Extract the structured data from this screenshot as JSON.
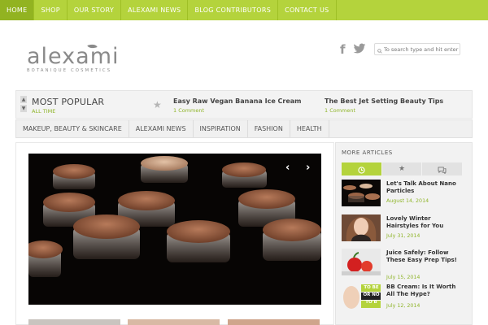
{
  "topnav": {
    "items": [
      "HOME",
      "SHOP",
      "OUR STORY",
      "ALEXAMI NEWS",
      "BLOG CONTRIBUTORS",
      "CONTACT US"
    ],
    "active_index": 0
  },
  "brand": {
    "name": "alexami",
    "tagline": "BOTANIQUE COSMETICS",
    "accent_color": "#b4d33c"
  },
  "social": {
    "facebook_icon": "facebook-icon",
    "twitter_icon": "twitter-icon"
  },
  "search": {
    "placeholder": "To search type and hit enter"
  },
  "popular": {
    "title": "MOST POPULAR",
    "subtitle": "ALL TIME",
    "posts": [
      {
        "title": "Easy Raw Vegan Banana Ice Cream",
        "comments": "1 Comment"
      },
      {
        "title": "The Best Jet Setting Beauty Tips",
        "comments": "1 Comment"
      }
    ]
  },
  "catnav": {
    "items": [
      "MAKEUP, BEAUTY & SKINCARE",
      "ALEXAMI NEWS",
      "INSPIRATION",
      "FASHION",
      "HEALTH"
    ]
  },
  "sidebar": {
    "title": "MORE ARTICLES",
    "tabs": [
      "clock-icon",
      "star-icon",
      "comments-icon"
    ],
    "active_tab": 0,
    "articles": [
      {
        "title": "Let's Talk About Nano Particles",
        "date": "August 14, 2014"
      },
      {
        "title": "Lovely Winter Hairstyles for You",
        "date": "July 31, 2014"
      },
      {
        "title": "Juice Safely: Follow These Easy Prep Tips!",
        "date": "July 15, 2014"
      },
      {
        "title": "BB Cream: Is It Worth All The Hype?",
        "date": "July 12, 2014"
      }
    ],
    "thumb3_overlay": [
      "TO BE",
      "OR NO",
      "TO B"
    ]
  }
}
